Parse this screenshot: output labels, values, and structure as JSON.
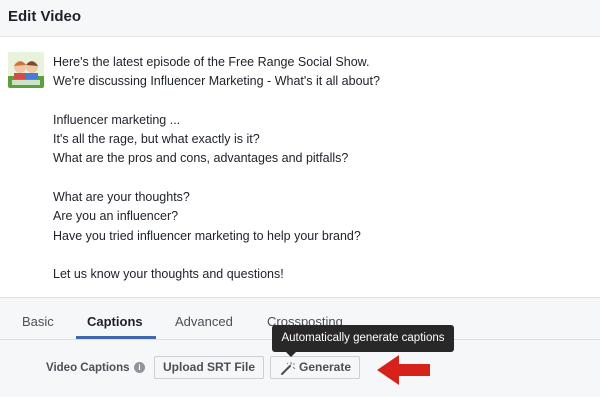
{
  "dialog": {
    "title": "Edit Video"
  },
  "post": {
    "thumbnail_icon": "show-avatar-thumbnail",
    "lines": [
      "Here's the latest episode of the Free Range Social Show.",
      "We're discussing Influencer Marketing - What's it all about?",
      "",
      "Influencer marketing ...",
      "It's all the rage, but what exactly is it?",
      "What are the pros and cons, advantages and pitfalls?",
      "",
      "What are your thoughts?",
      "Are you an influencer?",
      "Have you tried influencer marketing to help your brand?",
      "",
      "Let us know your thoughts and questions!"
    ]
  },
  "tabs": [
    {
      "label": "Basic"
    },
    {
      "label": "Captions",
      "active": true
    },
    {
      "label": "Advanced"
    },
    {
      "label": "Crossposting"
    }
  ],
  "captions": {
    "label": "Video Captions",
    "info_icon": "info-icon",
    "upload_label": "Upload SRT File",
    "generate_label": "Generate",
    "generate_icon": "magic-wand-icon"
  },
  "tooltip": {
    "text": "Automatically generate captions"
  },
  "annotation": {
    "arrow_icon": "red-arrow-icon",
    "color": "#d7221b"
  },
  "colors": {
    "accent": "#4267b2",
    "header_bg": "#f6f7f9"
  }
}
